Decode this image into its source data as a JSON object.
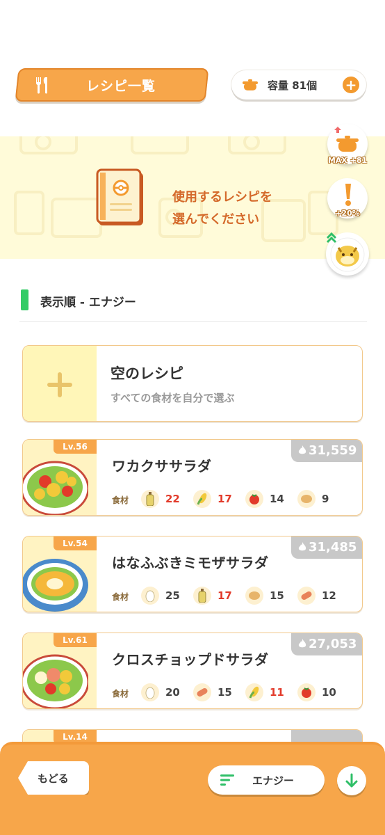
{
  "header": {
    "title": "レシピ一覧",
    "capacity_label": "容量 81個",
    "plus": "+"
  },
  "banner": {
    "line1": "使用するレシピを",
    "line2": "選んでください"
  },
  "side_buttons": [
    {
      "label": "MAX +81",
      "icon": "pot-up-icon"
    },
    {
      "label": "+20%",
      "icon": "exclamation-icon"
    },
    {
      "label": "",
      "icon": "pokemon-avatar-icon"
    }
  ],
  "sort": {
    "label": "表示順 - エナジー"
  },
  "empty_recipe": {
    "title": "空のレシピ",
    "subtitle": "すべての食材を自分で選ぶ"
  },
  "ingredients_label": "食材",
  "recipes": [
    {
      "level": "Lv.56",
      "name": "ワカクササラダ",
      "energy": "31,559",
      "ingredients": [
        {
          "icon": "oil-bottle-icon",
          "count": "22",
          "short": true
        },
        {
          "icon": "corn-icon",
          "count": "17",
          "short": true
        },
        {
          "icon": "tomato-icon",
          "count": "14",
          "short": false
        },
        {
          "icon": "potato-icon",
          "count": "9",
          "short": false
        }
      ]
    },
    {
      "level": "Lv.54",
      "name": "はなふぶきミモザサラダ",
      "energy": "31,485",
      "ingredients": [
        {
          "icon": "egg-icon",
          "count": "25",
          "short": false
        },
        {
          "icon": "oil-bottle-icon",
          "count": "17",
          "short": true
        },
        {
          "icon": "potato-icon",
          "count": "15",
          "short": false
        },
        {
          "icon": "sausage-icon",
          "count": "12",
          "short": false
        }
      ]
    },
    {
      "level": "Lv.61",
      "name": "クロスチョップドサラダ",
      "energy": "27,053",
      "ingredients": [
        {
          "icon": "egg-icon",
          "count": "20",
          "short": false
        },
        {
          "icon": "sausage-icon",
          "count": "15",
          "short": false
        },
        {
          "icon": "corn-icon",
          "count": "11",
          "short": true
        },
        {
          "icon": "tomato-icon",
          "count": "10",
          "short": false
        }
      ]
    }
  ],
  "partial_card": {
    "level": "Lv.14"
  },
  "bottom": {
    "back_label": "もどる",
    "sort_label": "エナジー"
  },
  "colors": {
    "accent": "#f7a64a",
    "banner": "#fffbd9",
    "shortage": "#e23a2a",
    "sort_marker": "#33cc66"
  }
}
